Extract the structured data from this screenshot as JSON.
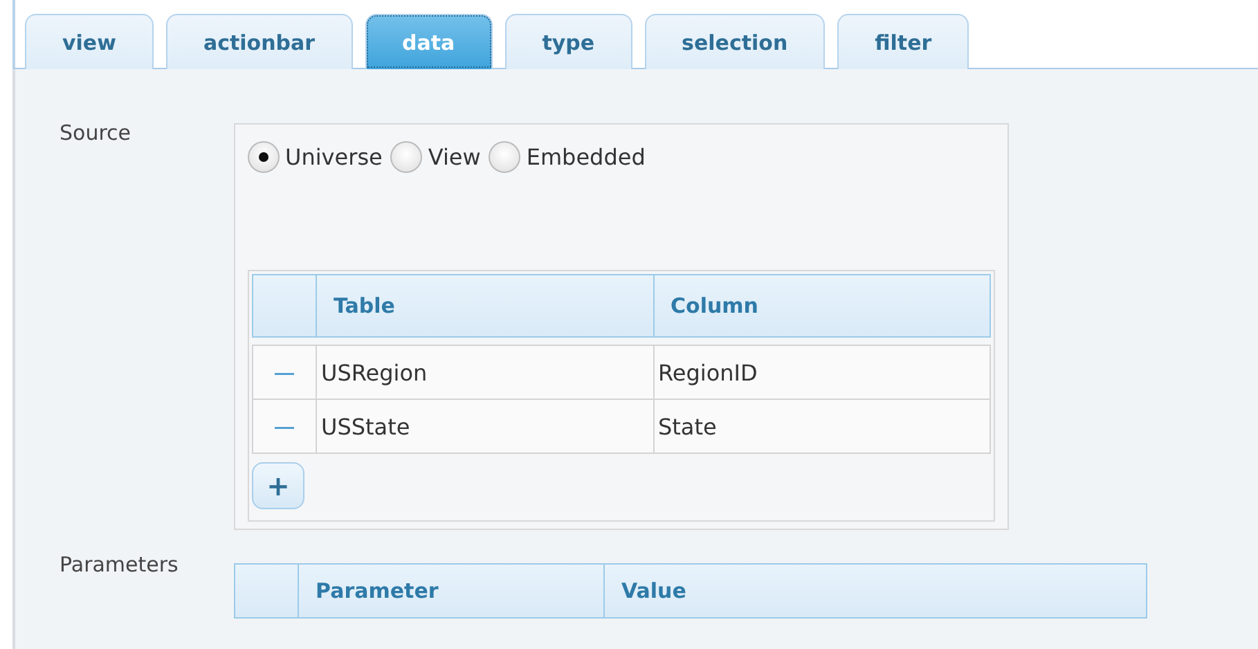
{
  "tabs": [
    {
      "label": "view",
      "selected": false
    },
    {
      "label": "actionbar",
      "selected": false
    },
    {
      "label": "data",
      "selected": true
    },
    {
      "label": "type",
      "selected": false
    },
    {
      "label": "selection",
      "selected": false
    },
    {
      "label": "filter",
      "selected": false
    }
  ],
  "source": {
    "label": "Source",
    "options": [
      {
        "label": "Universe",
        "selected": true
      },
      {
        "label": "View",
        "selected": false
      },
      {
        "label": "Embedded",
        "selected": false
      }
    ],
    "table": {
      "columns": [
        "Table",
        "Column"
      ],
      "rows": [
        {
          "remove": "—",
          "cells": [
            "USRegion",
            "RegionID"
          ]
        },
        {
          "remove": "—",
          "cells": [
            "USState",
            "State"
          ]
        }
      ],
      "add": "+"
    }
  },
  "parameters": {
    "label": "Parameters",
    "columns": [
      "Parameter",
      "Value"
    ]
  }
}
